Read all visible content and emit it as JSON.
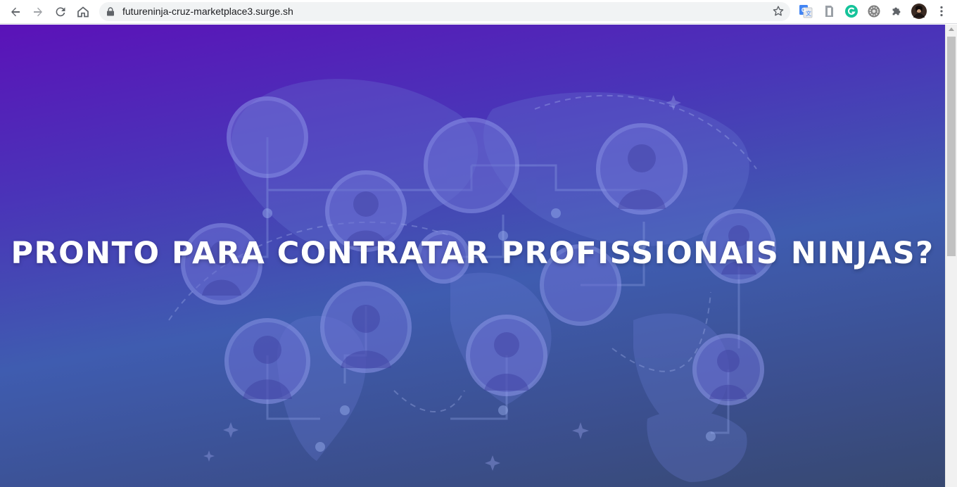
{
  "browser": {
    "url": "futureninja-cruz-marketplace3.surge.sh",
    "nav_icons": [
      "back-arrow-icon",
      "forward-arrow-icon",
      "reload-icon",
      "home-icon"
    ],
    "extensions": [
      "google-translate-icon",
      "document-icon",
      "grammarly-icon",
      "gear-icon",
      "puzzle-icon",
      "profile-avatar",
      "more-menu-icon"
    ]
  },
  "hero": {
    "title": "PRONTO PARA CONTRATAR PROFISSIONAIS NINJAS?",
    "background_start": "#5b12b8",
    "background_end": "#374870"
  }
}
